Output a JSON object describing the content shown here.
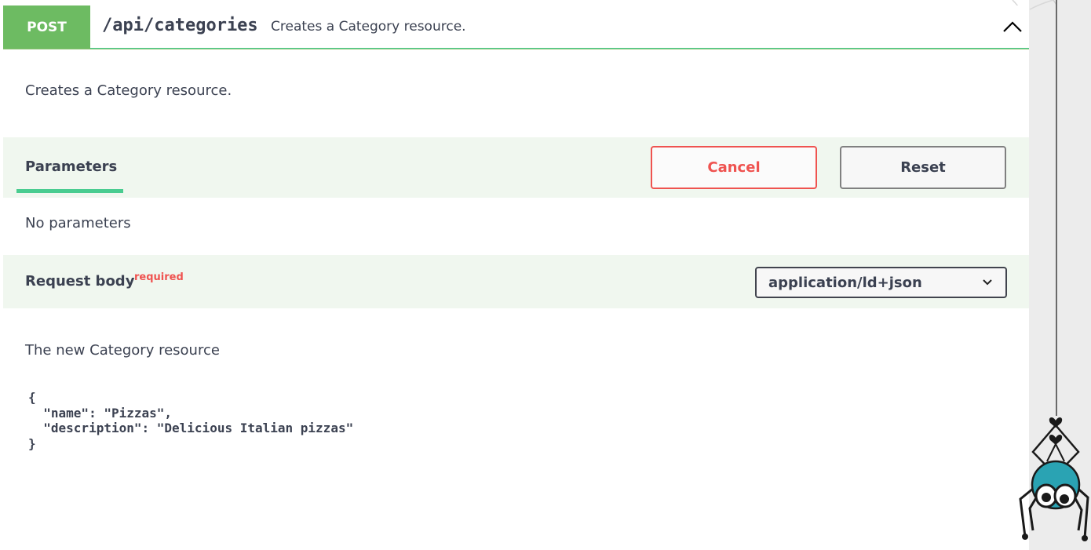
{
  "operation": {
    "method": "POST",
    "path": "/api/categories",
    "summary": "Creates a Category resource.",
    "description": "Creates a Category resource."
  },
  "parameters": {
    "tab_label": "Parameters",
    "cancel_label": "Cancel",
    "reset_label": "Reset",
    "empty_text": "No parameters"
  },
  "request_body": {
    "title": "Request body",
    "required_label": "required",
    "content_type": "application/ld+json",
    "description": "The new Category resource",
    "example": "{\n  \"name\": \"Pizzas\",\n  \"description\": \"Delicious Italian pizzas\"\n}"
  },
  "colors": {
    "post_method": "#6dbb62",
    "accent_green": "#49cc90",
    "cancel_red": "#ef5350",
    "section_bg": "#f0f7ef",
    "text": "#3b4151"
  },
  "icons": {
    "collapse": "chevron-up-icon",
    "select": "chevron-down-icon",
    "mascot": "spider-mascot-icon"
  }
}
